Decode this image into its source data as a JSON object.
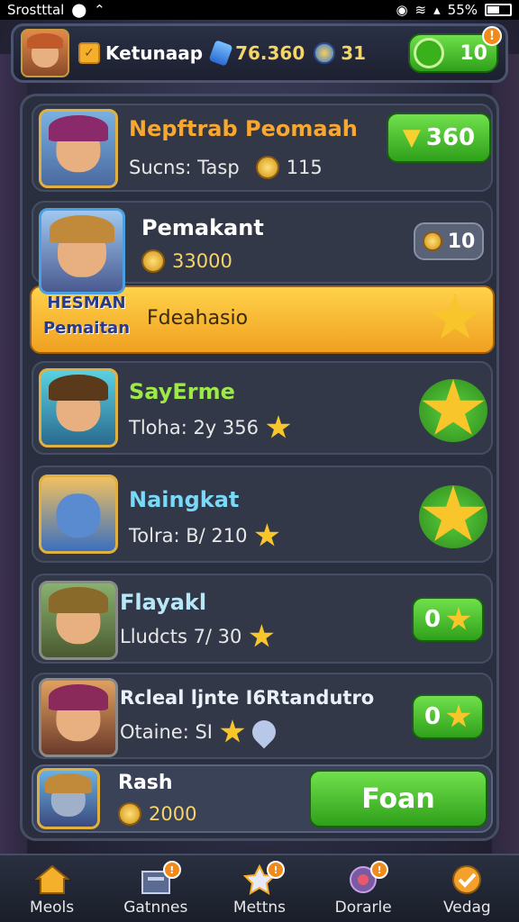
{
  "statusbar": {
    "carrier": "Srostttal",
    "battery": "55%"
  },
  "topbar": {
    "player_name": "Ketunaap",
    "gems": "76.360",
    "coins": "31",
    "energy": "10",
    "energy_notif": "!"
  },
  "header_row": {
    "title": "Nepftrab Peomaah",
    "subtitle": "Sucns: Tasp",
    "count": "115",
    "button_value": "360"
  },
  "featured": {
    "name": "Pemakant",
    "coins": "33000",
    "pill_value": "10",
    "banner_label_line1": "HESMAN",
    "banner_label_line2": "Pemaitan",
    "banner_text": "Fdeahasio"
  },
  "rows": [
    {
      "name": "SayErme",
      "stat": "Tloha: 2y 356",
      "name_color": "#9ee84a"
    },
    {
      "name": "Naingkat",
      "stat": "Tolra: B/ 210",
      "name_color": "#7ad8f8"
    },
    {
      "name": "Flayakl",
      "stat": "Lludcts 7/ 30",
      "button": "0",
      "name_color": "#b8e8f8"
    },
    {
      "name": "Rcleal ljnte I6Rtandutro",
      "stat": "Otaine: SI",
      "button": "0",
      "name_color": "#e8f0f8"
    }
  ],
  "footer_row": {
    "name": "Rash",
    "coins": "2000",
    "button": "Foan"
  },
  "nav": [
    {
      "label": "Meols",
      "icon": "home-icon"
    },
    {
      "label": "Gatnnes",
      "icon": "shop-icon",
      "notif": "!"
    },
    {
      "label": "Mettns",
      "icon": "star-icon",
      "notif": "!"
    },
    {
      "label": "Dorarle",
      "icon": "badge-icon",
      "notif": "!"
    },
    {
      "label": "Vedag",
      "icon": "check-icon"
    }
  ]
}
